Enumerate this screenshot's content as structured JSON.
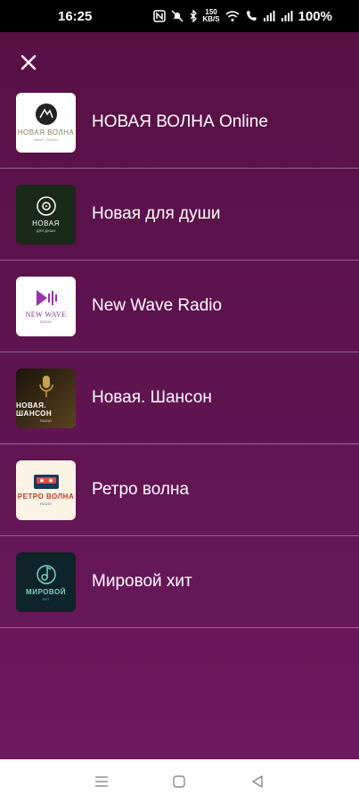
{
  "status_bar": {
    "time": "16:25",
    "net_speed_value": "150",
    "net_speed_unit": "KB/S",
    "battery": "100%"
  },
  "icons": {
    "close": "close-icon",
    "nfc": "nfc-icon",
    "mute": "bell-off-icon",
    "bluetooth": "bluetooth-icon",
    "wifi": "wifi-icon",
    "call": "wifi-call-icon",
    "signal": "signal-icon",
    "menu": "menu-icon",
    "home": "home-icon",
    "back": "back-icon"
  },
  "colors": {
    "background_top": "#581045",
    "background_bottom": "#6c1a5e",
    "divider": "rgba(255,255,255,0.35)"
  },
  "stations": [
    {
      "name": "НОВАЯ ВОЛНА Online",
      "logo_text": "НОВАЯ ВОЛНА",
      "logo_sub": "WAVE • RADIO",
      "logo_bg": "#ffffff",
      "logo_fg": "#8a7a5a"
    },
    {
      "name": "Новая для души",
      "logo_text": "НОВАЯ",
      "logo_sub": "ДЛЯ ДУШИ",
      "logo_bg": "#1a2a18",
      "logo_fg": "#ffffff"
    },
    {
      "name": "New Wave Radio",
      "logo_text": "NEW WAVE",
      "logo_sub": "RADIO",
      "logo_bg": "#ffffff",
      "logo_fg": "#7a2f8a"
    },
    {
      "name": "Новая. Шансон",
      "logo_text": "НОВАЯ. ШАНСОН",
      "logo_sub": "RADIO",
      "logo_bg": "#2a200f",
      "logo_fg": "#ffffff"
    },
    {
      "name": "Ретро волна",
      "logo_text": "РЕТРО ВОЛНА",
      "logo_sub": "RADIO",
      "logo_bg": "#fbf3e4",
      "logo_fg": "#1b3a5a"
    },
    {
      "name": "Мировой хит",
      "logo_text": "МИРОВОЙ",
      "logo_sub": "ХИТ",
      "logo_bg": "#0f2428",
      "logo_fg": "#7ad0c8"
    }
  ]
}
